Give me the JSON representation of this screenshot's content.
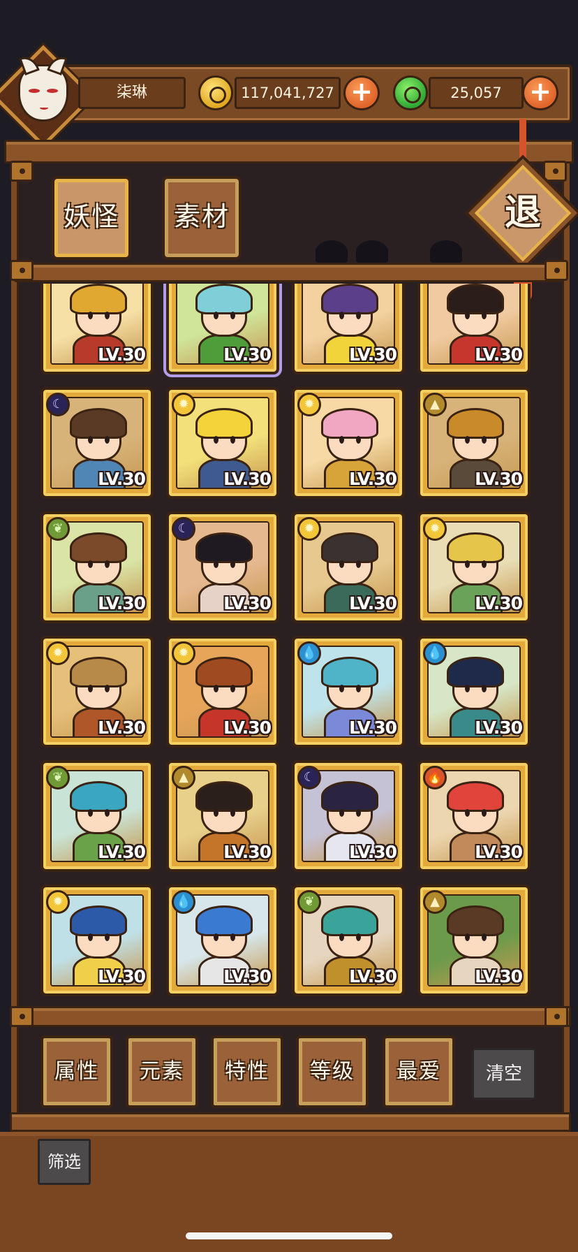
{
  "header": {
    "player_name": "柒琳",
    "gold_amount": "117,041,727",
    "gem_amount": "25,057",
    "plus_symbol": "+"
  },
  "tabs": [
    {
      "label": "妖怪",
      "active": true
    },
    {
      "label": "素材",
      "active": false
    }
  ],
  "exit_label": "退",
  "characters": [
    {
      "level": "LV.30",
      "element": null,
      "palette": [
        "#f6e0a6",
        "#e0a830",
        "#b83a2a"
      ]
    },
    {
      "level": "LV.30",
      "element": null,
      "palette": [
        "#cfe59a",
        "#7fcfd8",
        "#4f9d3a"
      ],
      "selected": true
    },
    {
      "level": "LV.30",
      "element": null,
      "palette": [
        "#f3d2a0",
        "#5b3f8a",
        "#f1d33a"
      ]
    },
    {
      "level": "LV.30",
      "element": null,
      "palette": [
        "#f0caa0",
        "#2b1d1a",
        "#c6362c"
      ]
    },
    {
      "level": "LV.30",
      "element": "moon",
      "palette": [
        "#d7b37a",
        "#5a3a25",
        "#4f86b6"
      ]
    },
    {
      "level": "LV.30",
      "element": "sun",
      "palette": [
        "#f3e07a",
        "#f4d23a",
        "#3f5a8f"
      ]
    },
    {
      "level": "LV.30",
      "element": "sun",
      "palette": [
        "#f6d9a4",
        "#f1a6c2",
        "#d7a43a"
      ]
    },
    {
      "level": "LV.30",
      "element": "earth",
      "palette": [
        "#d7b37a",
        "#c98a2a",
        "#5a4a3a"
      ]
    },
    {
      "level": "LV.30",
      "element": "leaf",
      "palette": [
        "#d9e4a6",
        "#7a4a2a",
        "#6aa08a"
      ]
    },
    {
      "level": "LV.30",
      "element": "moon",
      "palette": [
        "#e6b890",
        "#1f1a22",
        "#e6d2c6"
      ]
    },
    {
      "level": "LV.30",
      "element": "sun",
      "palette": [
        "#e7c990",
        "#3a3230",
        "#3a6a5a"
      ]
    },
    {
      "level": "LV.30",
      "element": "sun",
      "palette": [
        "#e8ddb5",
        "#e5c54a",
        "#6aa25a"
      ]
    },
    {
      "level": "LV.30",
      "element": "sun",
      "palette": [
        "#e6bf7a",
        "#b88a4a",
        "#b0572a"
      ]
    },
    {
      "level": "LV.30",
      "element": "sun",
      "palette": [
        "#e7a55a",
        "#a04a22",
        "#c5352a"
      ]
    },
    {
      "level": "LV.30",
      "element": "water",
      "palette": [
        "#bfe3ea",
        "#4fb4c8",
        "#7a8ad8"
      ]
    },
    {
      "level": "LV.30",
      "element": "water",
      "palette": [
        "#d6e6c6",
        "#1f2a4a",
        "#3a8a8a"
      ]
    },
    {
      "level": "LV.30",
      "element": "leaf",
      "palette": [
        "#c9e4d6",
        "#3aa6c0",
        "#6aa24a"
      ]
    },
    {
      "level": "LV.30",
      "element": "earth",
      "palette": [
        "#e8cf8a",
        "#2a1f1a",
        "#c5752a"
      ]
    },
    {
      "level": "LV.30",
      "element": "moon",
      "palette": [
        "#c6c2d6",
        "#2a2440",
        "#e6e6f0"
      ]
    },
    {
      "level": "LV.30",
      "element": "fire",
      "palette": [
        "#ecd6b0",
        "#e0443a",
        "#c28a5a"
      ]
    },
    {
      "level": "LV.30",
      "element": "sun",
      "palette": [
        "#bfe0e6",
        "#2d5aa8",
        "#f0d04a"
      ]
    },
    {
      "level": "LV.30",
      "element": "water",
      "palette": [
        "#d6e6ea",
        "#3a7ad0",
        "#e6e6e6"
      ]
    },
    {
      "level": "LV.30",
      "element": "leaf",
      "palette": [
        "#e6d6c0",
        "#3aa49a",
        "#c0902a"
      ]
    },
    {
      "level": "LV.30",
      "element": "earth",
      "palette": [
        "#6a9a4a",
        "#5a3a25",
        "#e6d6c0"
      ]
    }
  ],
  "element_icons": {
    "moon": "☾",
    "sun": "✹",
    "leaf": "❦",
    "earth": "▲",
    "water": "💧",
    "fire": "🔥"
  },
  "filters": [
    "属性",
    "元素",
    "特性",
    "等级",
    "最爱"
  ],
  "clear_label": "清空",
  "screen_label": "筛选"
}
